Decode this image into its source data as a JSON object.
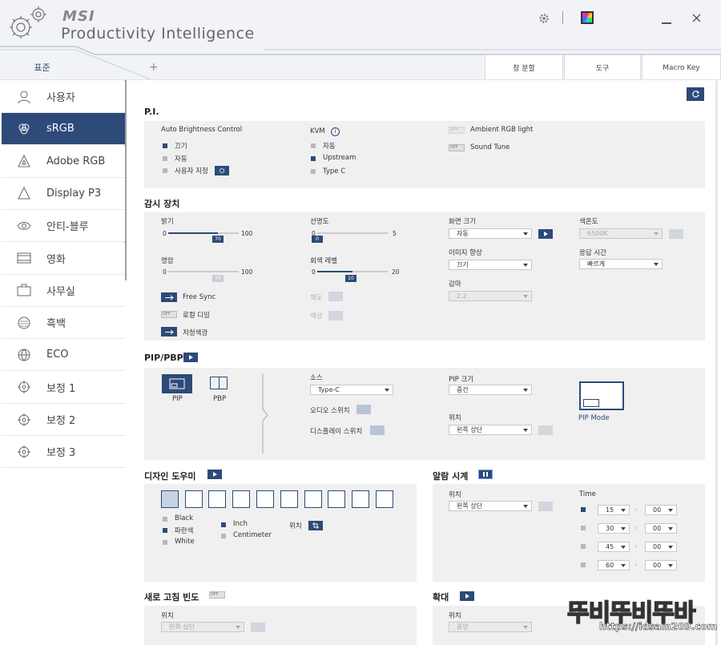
{
  "app": {
    "brand": "MSI",
    "title": "Productivity Intelligence"
  },
  "tabs": {
    "active": "표준",
    "add": "+",
    "right": [
      "창 분할",
      "도구",
      "Macro Key"
    ]
  },
  "sidebar": {
    "items": [
      {
        "label": "사용자",
        "icon": "user-icon"
      },
      {
        "label": "sRGB",
        "icon": "srgb-icon",
        "active": true
      },
      {
        "label": "Adobe RGB",
        "icon": "adobe-rgb-icon"
      },
      {
        "label": "Display P3",
        "icon": "triangle-icon"
      },
      {
        "label": "안티-블루",
        "icon": "eye-icon"
      },
      {
        "label": "영화",
        "icon": "film-icon"
      },
      {
        "label": "사무실",
        "icon": "briefcase-icon"
      },
      {
        "label": "흑백",
        "icon": "grayscale-icon"
      },
      {
        "label": "ECO",
        "icon": "globe-icon"
      },
      {
        "label": "보정 1",
        "icon": "crosshair-icon"
      },
      {
        "label": "보정 2",
        "icon": "crosshair-icon"
      },
      {
        "label": "보정 3",
        "icon": "crosshair-icon"
      }
    ]
  },
  "pi": {
    "title": "P.I.",
    "abc": {
      "title": "Auto Brightness Control",
      "options": [
        "끄기",
        "자동",
        "사용자 지정"
      ],
      "selected": 0
    },
    "kvm": {
      "title": "KVM",
      "options": [
        "자동",
        "Upstream",
        "Type C"
      ],
      "selected": 1
    },
    "ambient": "Ambient RGB light",
    "sound": "Sound Tune",
    "off": "OFF"
  },
  "monitor": {
    "title": "감시 장치",
    "brightness": {
      "label": "밝기",
      "min": "0",
      "max": "100",
      "value": "70"
    },
    "sharpness": {
      "label": "선명도",
      "min": "0",
      "max": "5",
      "value": "0"
    },
    "contrast": {
      "label": "명암",
      "min": "0",
      "max": "100",
      "value": "70"
    },
    "gray": {
      "label": "회색 레벨",
      "min": "0",
      "max": "20",
      "value": "10"
    },
    "freesync": "Free Sync",
    "local_dimming": "로컬 디밍",
    "low_blue": "저청색광",
    "saturation": "채도",
    "hue": "색상",
    "screen_size": {
      "label": "화면 크기",
      "value": "자동"
    },
    "image_enh": {
      "label": "이미지 향상",
      "value": "끄기"
    },
    "gamma": {
      "label": "감마",
      "value": "2.2"
    },
    "color_temp": {
      "label": "색온도",
      "value": "6500K"
    },
    "response": {
      "label": "응답 시간",
      "value": "빠르게"
    }
  },
  "pip": {
    "title": "PIP/PBP",
    "modes": [
      "PIP",
      "PBP"
    ],
    "source": {
      "label": "소스",
      "value": "Type-C"
    },
    "audio": "오디오 스위치",
    "display": "디스플레이 스위치",
    "size": {
      "label": "PIP 크기",
      "value": "중간"
    },
    "position": {
      "label": "위치",
      "value": "왼쪽 상단"
    },
    "mode_label": "PIP Mode"
  },
  "design": {
    "title": "디자인 도우미",
    "colors": [
      "Black",
      "파란색",
      "White"
    ],
    "units": [
      "Inch",
      "Centimeter"
    ],
    "position": "위치"
  },
  "alarm": {
    "title": "알람 시계",
    "position_label": "위치",
    "position_value": "왼쪽 상단",
    "time_label": "Time",
    "rows": [
      {
        "m": "15",
        "s": "00"
      },
      {
        "m": "30",
        "s": "00"
      },
      {
        "m": "45",
        "s": "00"
      },
      {
        "m": "60",
        "s": "00"
      }
    ]
  },
  "refresh": {
    "title": "새로 고침 빈도",
    "position_label": "위치",
    "position_value": "왼쪽 상단"
  },
  "zoom": {
    "title": "확대",
    "position_label": "위치",
    "position_value": "중앙"
  },
  "watermark": {
    "title": "뚜비뚜비뚜바",
    "url": "https://idsam209.com"
  }
}
